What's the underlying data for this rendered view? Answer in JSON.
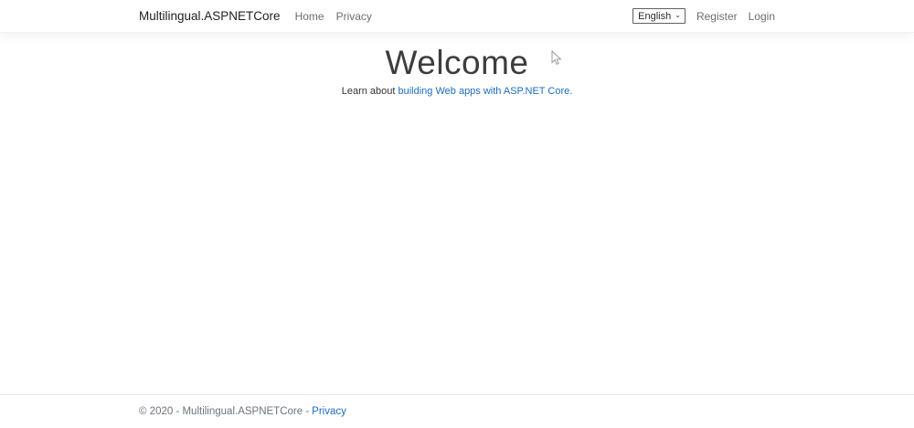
{
  "navbar": {
    "brand": "Multilingual.ASPNETCore",
    "links": [
      {
        "label": "Home"
      },
      {
        "label": "Privacy"
      }
    ],
    "language_select": {
      "selected": "English",
      "chevron_icon": "⌄"
    },
    "auth_links": [
      {
        "label": "Register"
      },
      {
        "label": "Login"
      }
    ]
  },
  "main": {
    "heading": "Welcome",
    "intro_prefix": "Learn about ",
    "intro_link": "building Web apps with ASP.NET Core."
  },
  "footer": {
    "copyright": "© 2020 - Multilingual.ASPNETCore -",
    "privacy_link": "Privacy"
  },
  "colors": {
    "link_blue": "#1b6ec2",
    "nav_link_gray": "#6d6d6d",
    "heading_gray": "#3d3d3d",
    "footer_muted": "#6c757d",
    "navbar_bg": "#ffffff"
  }
}
